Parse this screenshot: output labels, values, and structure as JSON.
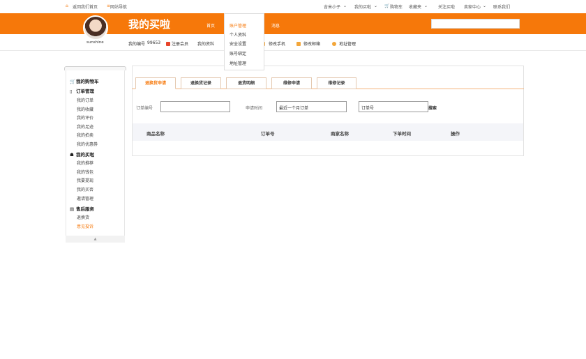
{
  "topbar": {
    "home_label": "返回我们首页",
    "site_nav_label": "网站导航",
    "user_name": "吉米小子",
    "my_maila": "我的买啦",
    "cart": "购物车",
    "favorites": "收藏夹",
    "follow": "关注买啦",
    "seller_center": "卖家中心",
    "contact": "联系我们"
  },
  "header": {
    "brand": "我的买啦",
    "nav": [
      "首页",
      "账户管理",
      "消息"
    ],
    "username": "sunshine"
  },
  "dropdown": {
    "title": "账户管理",
    "items": [
      "个人资料",
      "安全设置",
      "账号绑定",
      "地址管理"
    ]
  },
  "subrow": {
    "account_label": "我的编号",
    "account_no": "99653",
    "member": "注册会员",
    "my_profile": "我的资料",
    "phone": "修改手机",
    "email": "修改邮箱",
    "address": "地址管理"
  },
  "sidebar": {
    "sections": [
      {
        "title": "我的购物车",
        "items": []
      },
      {
        "title": "订单管理",
        "items": [
          "我的订单",
          "我的收藏",
          "我的评价",
          "我的足迹",
          "我的拍卖",
          "我的优惠券"
        ]
      },
      {
        "title": "我的买啦",
        "items": [
          "我的推荐",
          "我的钱包",
          "我要提现",
          "我的买否",
          "邀请管理"
        ]
      },
      {
        "title": "售后服务",
        "items": [
          "退换货",
          "意见投诉"
        ]
      }
    ],
    "active_item": "意见投诉"
  },
  "tabs": [
    "退换货申请",
    "退换货记录",
    "退货明细",
    "维修申请",
    "维修记录"
  ],
  "filters": {
    "order_no_label": "订单编号",
    "order_no_value": "",
    "apply_time_label": "申请时间",
    "apply_time_value": "最近一个月订单",
    "order_input_value": "订单号",
    "search_label": "搜索"
  },
  "table": {
    "headers": [
      "商品名称",
      "订单号",
      "商家名称",
      "下单时间",
      "操作"
    ]
  },
  "colors": {
    "brand_orange": "#f6780a"
  }
}
